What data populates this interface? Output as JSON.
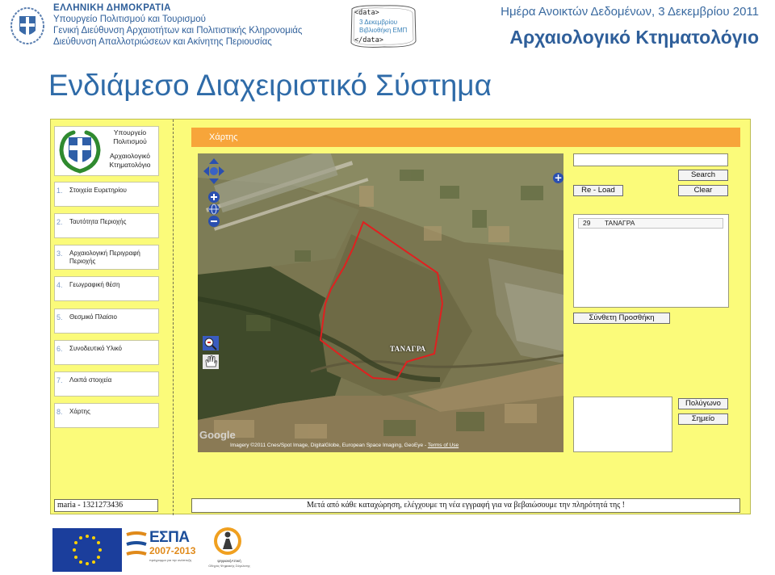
{
  "header": {
    "ministry_lines": [
      "ΕΛΛΗΝΙΚΗ ΔΗΜΟΚΡΑΤΙΑ",
      "Υπουργείο Πολιτισμού και Τουρισμού",
      "Γενική Διεύθυνση Αρχαιοτήτων και Πολιτιστικής Κληρονομιάς",
      "Διεύθυνση Απαλλοτριώσεων και Ακίνητης Περιουσίας"
    ],
    "badge": {
      "open_tag": "<data>",
      "line1": "3 Δεκεμβρίου",
      "line2": "Βιβλιοθήκη ΕΜΠ",
      "close_tag": "</data>"
    },
    "event_title": "Ημέρα Ανοικτών Δεδομένων, 3 Δεκεμβρίου 2011",
    "cadastre_title": "Αρχαιολογικό Κτηματολόγιο"
  },
  "page_title": "Ενδιάμεσο Διαχειριστικό Σύστημα",
  "app": {
    "logo": {
      "line1": "Υπουργείο",
      "line2": "Πολιτισμού",
      "line3": "Αρχαιολογικό",
      "line4": "Κτηματολόγιο"
    },
    "menu": [
      {
        "num": "1.",
        "label": "Στοιχεία Ευρετηρίου"
      },
      {
        "num": "2.",
        "label": "Ταυτότητα Περιοχής"
      },
      {
        "num": "3.",
        "label": "Αρχαιολογική Περιγραφή Περιοχής"
      },
      {
        "num": "4.",
        "label": "Γεωγραφική θέση"
      },
      {
        "num": "5.",
        "label": "Θεσμικό Πλαίσιο"
      },
      {
        "num": "6.",
        "label": "Συνοδευτικό Υλικό"
      },
      {
        "num": "7.",
        "label": "Λοιπά στοιχεία"
      },
      {
        "num": "8.",
        "label": "Χάρτης"
      }
    ],
    "panel_title": "Χάρτης",
    "map": {
      "town_label": "ΤΑΝΑΓΡΑ",
      "provider": "Google",
      "attribution": "Imagery ©2011 Cnes/Spot Image, DigitalGlobe, European Space Imaging, GeoEye - ",
      "terms": "Terms of Use"
    },
    "search": {
      "value": "",
      "button": "Search"
    },
    "reload_button": "Re - Load",
    "clear_button": "Clear",
    "results": [
      {
        "num": "29",
        "name": "ΤΑΝΑΓΡΑ"
      }
    ],
    "composite_add_button": "Σύνθετη Προσθήκη",
    "polygon_button": "Πολύγωνο",
    "point_button": "Σημείο",
    "user_status": "maria - 1321273436",
    "notice": "Μετά από κάθε καταχώρηση, ελέγχουμε τη νέα εγγραφή για να βεβαιώσουμε την πληρότητά της !"
  },
  "footer": {
    "espa_word": "ΕΣΠΑ",
    "espa_years": "2007-2013",
    "espa_slogan": "πρόγραμμα για την ανάπτυξη",
    "digital_line1": "ψηφιακήΑττική",
    "digital_line2": "Οδηγός Ψηφιακής Σύγκλισης"
  },
  "colors": {
    "brand_blue": "#2f6ba8",
    "app_background": "#fbfb7a",
    "panel_header": "#f7a53a",
    "boundary": "#e02020"
  }
}
